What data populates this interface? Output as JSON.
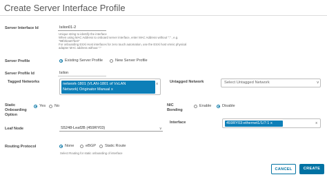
{
  "dialog": {
    "title": "Create Server Interface Profile"
  },
  "fields": {
    "server_interface_id": {
      "label": "Server Interface Id",
      "value": "Isilon01-2",
      "help": [
        "Unique string to identify the interface",
        "When using MAC Address to onboard server interface, enter MAC Address without \":\" , e.g.",
        "\"98f2b2a07be0\"",
        "For onboarding ESXi Host interfaces for zero touch automation, use the ESXi host vmnic physical",
        "adapter MAC address without \":\""
      ]
    },
    "server_profile": {
      "label": "Server Profile",
      "options": [
        "Existing Server Profile",
        "New Server Profile"
      ],
      "selected": "Existing Server Profile"
    },
    "server_profile_id": {
      "label": "Server Profile Id",
      "value": "Isilon"
    },
    "tagged_networks": {
      "label": "Tagged Networks",
      "chip_lines": [
        "network-1801 (VLAN-1801 of VxLAN",
        "Network) Originator Manual"
      ],
      "chip_remove": "x",
      "clear_icon": "x"
    },
    "untagged_network": {
      "label": "Untagged Network",
      "placeholder": "Select Untagged Network",
      "chevron": "v"
    },
    "static_onboarding": {
      "label_lines": [
        "Static",
        "Onboarding",
        "Option"
      ],
      "options": [
        "Yes",
        "No"
      ],
      "selected": "Yes"
    },
    "nic_bonding": {
      "label_lines": [
        "NIC",
        "Bonding"
      ],
      "options": [
        "Enable",
        "Disable"
      ],
      "selected": "Disable"
    },
    "leaf_node": {
      "label": "Leaf Node",
      "value": "S5248-Leaf2B (459RY03)",
      "chevron": "v"
    },
    "interface": {
      "label": "Interface",
      "chip": "459RY03:ethernet1/1/7:1",
      "chip_remove": "x",
      "clear_icon": "x"
    },
    "routing_protocol": {
      "label": "Routing Protocol",
      "options": [
        "None",
        "eBGP",
        "Static Route"
      ],
      "selected": "None",
      "help": "Select Routing for static onboarding of interface"
    }
  },
  "buttons": {
    "cancel": "CANCEL",
    "create": "CREATE"
  },
  "colors": {
    "accent": "#0072a3",
    "chip": "#0d7fb8"
  }
}
